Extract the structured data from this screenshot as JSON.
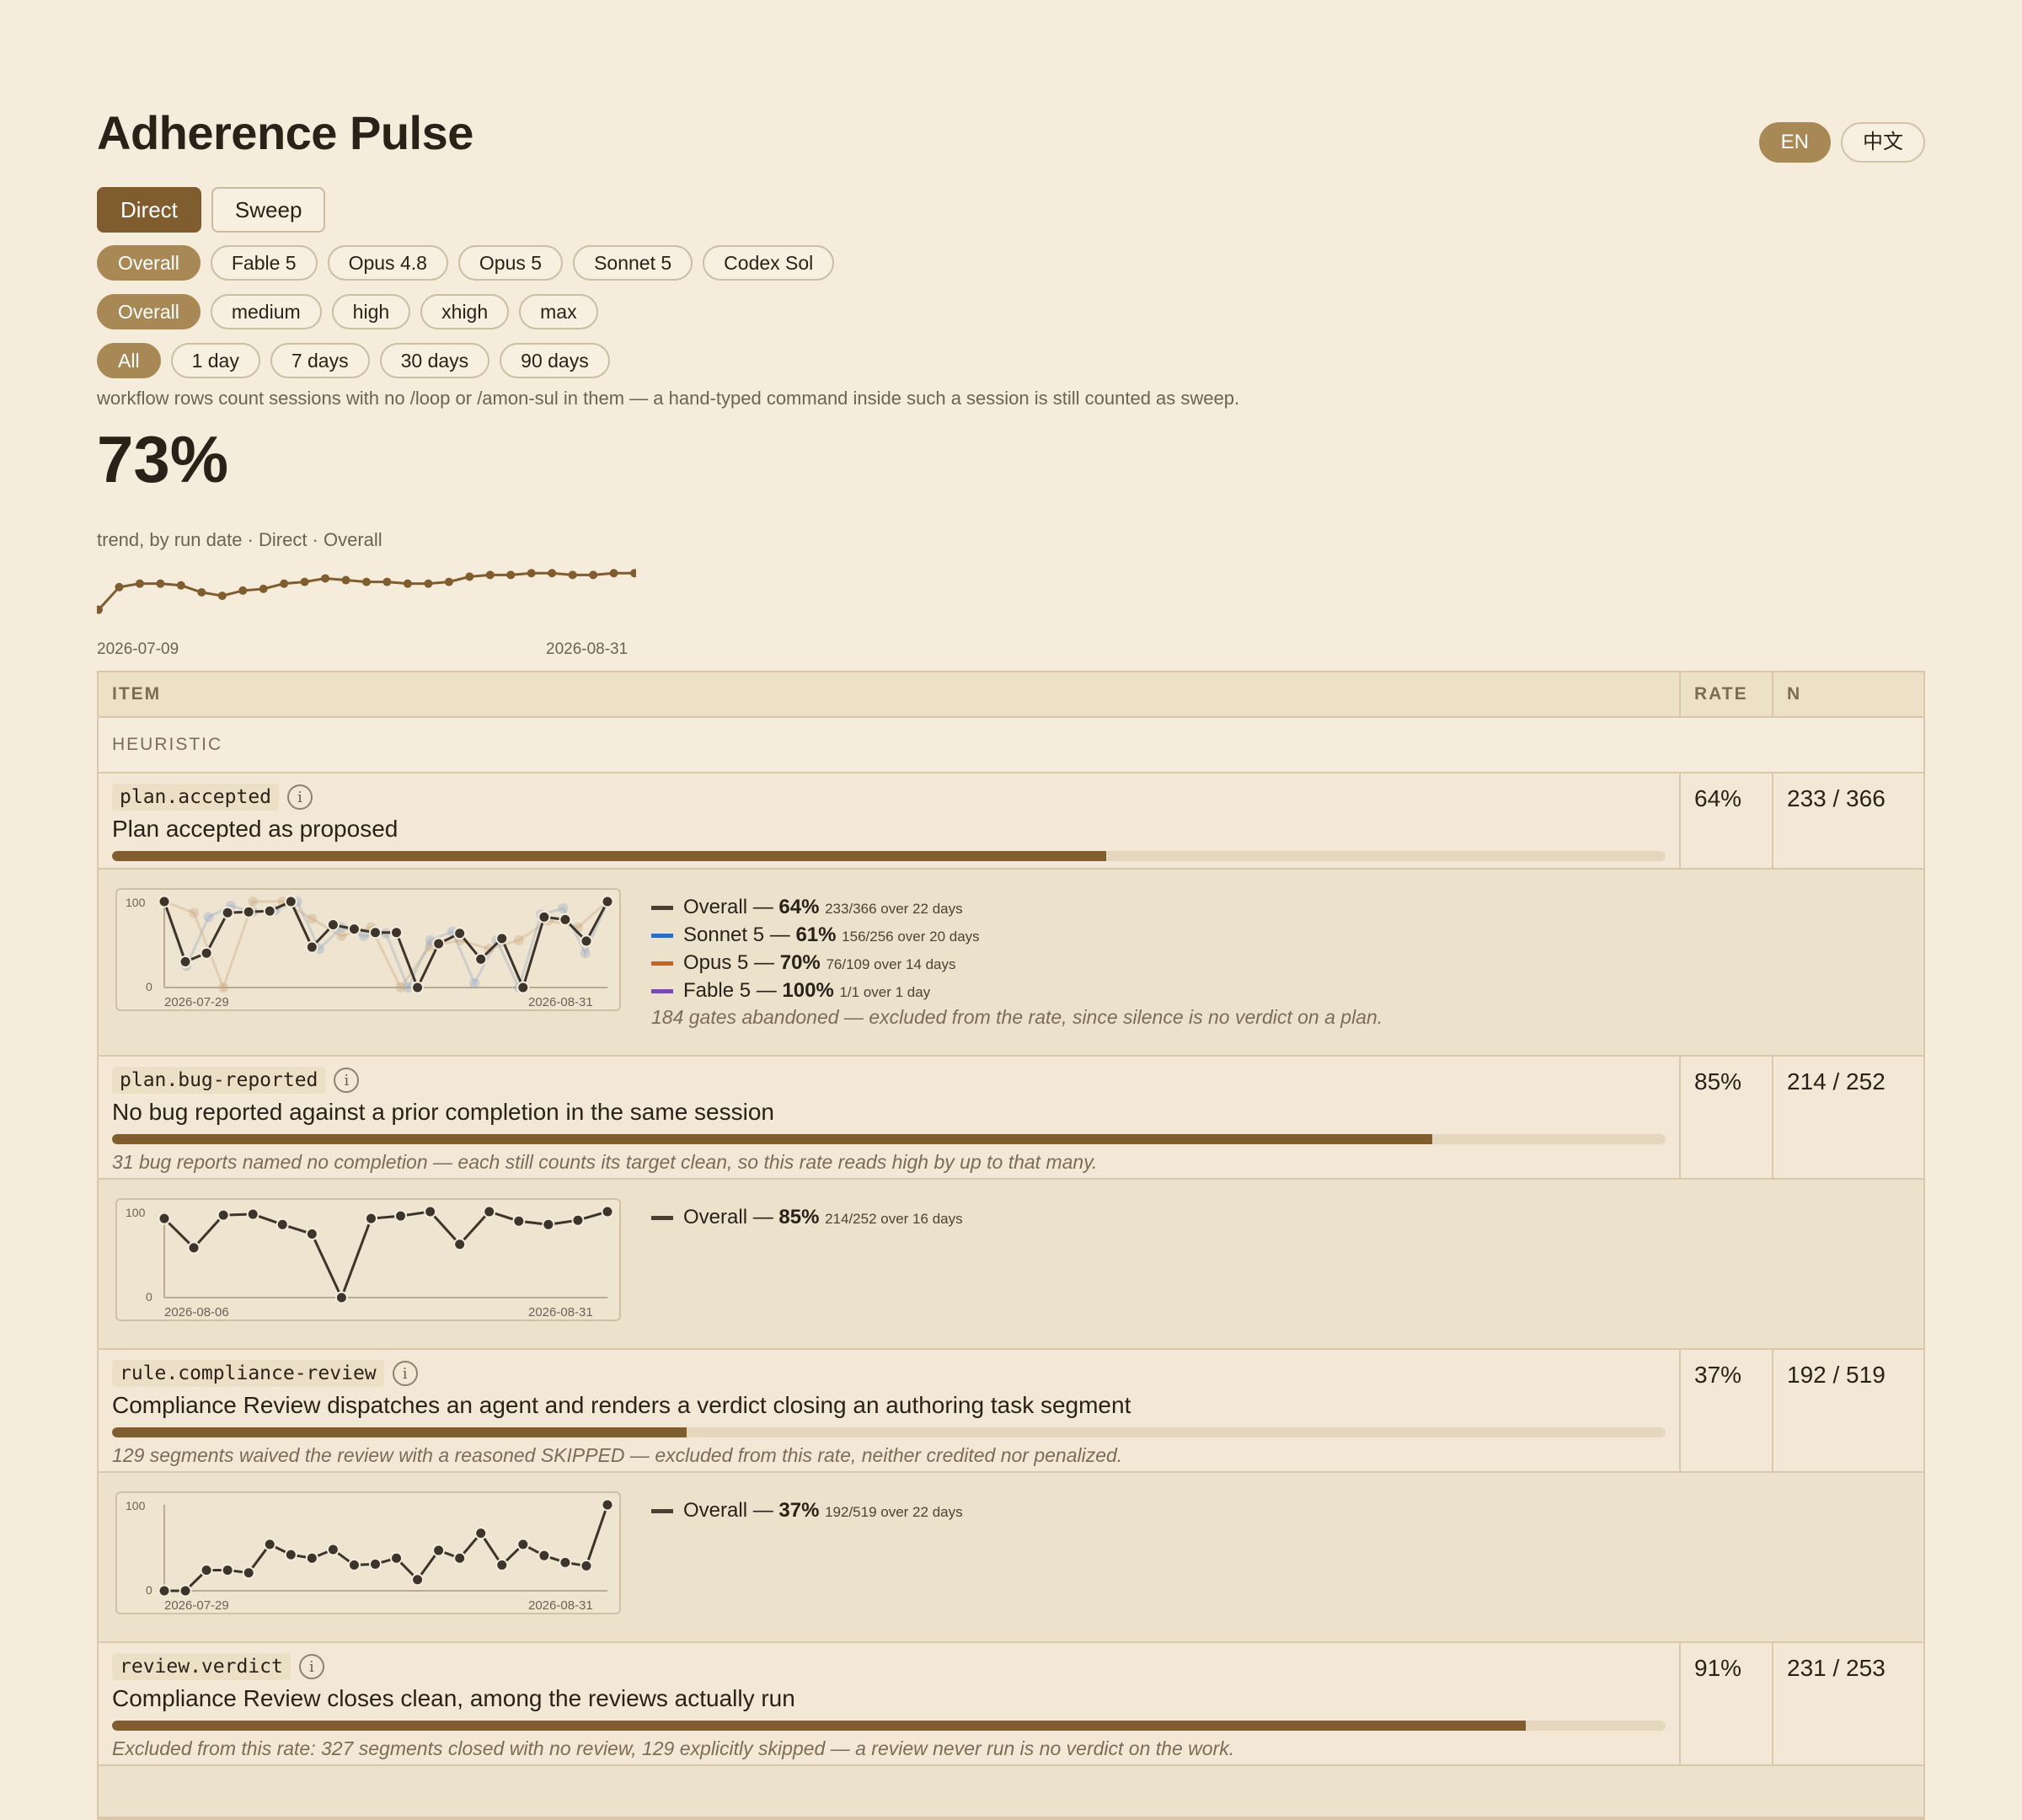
{
  "title": "Adherence Pulse",
  "lang": [
    "EN",
    "中文"
  ],
  "modes": [
    "Direct",
    "Sweep"
  ],
  "models": [
    "Overall",
    "Fable 5",
    "Opus 4.8",
    "Opus 5",
    "Sonnet 5",
    "Codex Sol"
  ],
  "efforts": [
    "Overall",
    "medium",
    "high",
    "xhigh",
    "max"
  ],
  "ranges": [
    "All",
    "1 day",
    "7 days",
    "30 days",
    "90 days"
  ],
  "note": "workflow rows count sessions with no /loop or /amon-sul in them — a hand-typed command inside such a session is still counted as sweep.",
  "headline": "73%",
  "trend": {
    "caption": "trend, by run date · Direct · Overall",
    "x_start": "2026-07-09",
    "x_end": "2026-08-31",
    "color": "#7f5d2e"
  },
  "table": {
    "headers": [
      "ITEM",
      "RATE",
      "N"
    ],
    "section": "HEURISTIC",
    "rows": [
      {
        "code": "plan.accepted",
        "desc": "Plan accepted as proposed",
        "rate": "64%",
        "n": "233 / 366",
        "fill": 0.64,
        "note": "",
        "chart": {
          "ymax": "100",
          "ymin": "0",
          "x_start": "2026-07-29",
          "x_end": "2026-08-31",
          "legend": [
            {
              "name": "Overall",
              "rate": "64%",
              "detail": "233/366 over 22 days",
              "color": "#4a3f33"
            },
            {
              "name": "Sonnet 5",
              "rate": "61%",
              "detail": "156/256 over 20 days",
              "color": "#2c6bc4"
            },
            {
              "name": "Opus 5",
              "rate": "70%",
              "detail": "76/109 over 14 days",
              "color": "#c8621e"
            },
            {
              "name": "Fable 5",
              "rate": "100%",
              "detail": "1/1 over 1 day",
              "color": "#7a4ab0"
            }
          ],
          "footnote": "184 gates abandoned — excluded from the rate, since silence is no verdict on a plan."
        }
      },
      {
        "code": "plan.bug-reported",
        "desc": "No bug reported against a prior completion in the same session",
        "rate": "85%",
        "n": "214 / 252",
        "fill": 0.85,
        "note": "31 bug reports named no completion — each still counts its target clean, so this rate reads high by up to that many.",
        "chart": {
          "ymax": "100",
          "ymin": "0",
          "x_start": "2026-08-06",
          "x_end": "2026-08-31",
          "legend": [
            {
              "name": "Overall",
              "rate": "85%",
              "detail": "214/252 over 16 days",
              "color": "#4a3f33"
            }
          ],
          "footnote": ""
        }
      },
      {
        "code": "rule.compliance-review",
        "desc": "Compliance Review dispatches an agent and renders a verdict closing an authoring task segment",
        "rate": "37%",
        "n": "192 / 519",
        "fill": 0.37,
        "note": "129 segments waived the review with a reasoned SKIPPED — excluded from this rate, neither credited nor penalized.",
        "chart": {
          "ymax": "100",
          "ymin": "0",
          "x_start": "2026-07-29",
          "x_end": "2026-08-31",
          "legend": [
            {
              "name": "Overall",
              "rate": "37%",
              "detail": "192/519 over 22 days",
              "color": "#4a3f33"
            }
          ],
          "footnote": ""
        }
      },
      {
        "code": "review.verdict",
        "desc": "Compliance Review closes clean, among the reviews actually run",
        "rate": "91%",
        "n": "231 / 253",
        "fill": 0.91,
        "note": "Excluded from this rate: 327 segments closed with no review, 129 explicitly skipped — a review never run is no verdict on the work.",
        "chart": null
      }
    ]
  },
  "series": {
    "trend": [
      60,
      73,
      75,
      75,
      74,
      70,
      68,
      71,
      72,
      75,
      76,
      78,
      77,
      76,
      76,
      75,
      75,
      76,
      79,
      80,
      80,
      81,
      81,
      80,
      80,
      81,
      81
    ],
    "r0_overall": [
      100,
      30,
      40,
      87,
      88,
      89,
      100,
      47,
      73,
      68,
      64,
      64,
      0,
      51,
      63,
      33,
      57,
      0,
      82,
      79,
      54,
      100
    ],
    "r0_sonnet": [
      100,
      25,
      82,
      95,
      88,
      90,
      100,
      45,
      70,
      60,
      63,
      0,
      55,
      65,
      5,
      55,
      0,
      85,
      92,
      40,
      100
    ],
    "r0_opus": [
      100,
      87,
      0,
      100,
      100,
      80,
      60,
      70,
      0,
      48,
      55,
      45,
      55,
      78,
      70,
      100
    ],
    "r1_overall": [
      92,
      58,
      96,
      97,
      85,
      74,
      0,
      92,
      95,
      100,
      62,
      100,
      89,
      85,
      90,
      100
    ],
    "r2_overall": [
      0,
      0,
      24,
      24,
      21,
      54,
      42,
      38,
      48,
      30,
      31,
      38,
      13,
      47,
      38,
      67,
      30,
      54,
      41,
      33,
      29,
      100
    ]
  }
}
